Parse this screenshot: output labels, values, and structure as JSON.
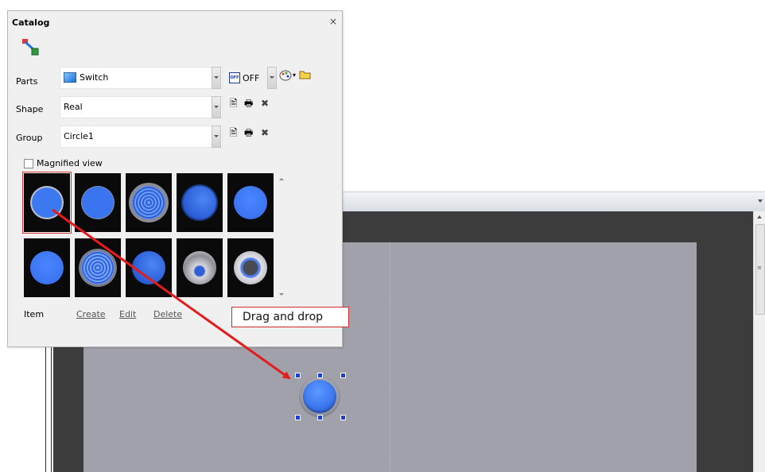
{
  "catalog": {
    "title": "Catalog",
    "close_glyph": "×",
    "parts_label": "Parts",
    "parts_value": "Switch",
    "parts_icon": "switch-icon",
    "state_value": "OFF",
    "shape_label": "Shape",
    "shape_value": "Real",
    "group_label": "Group",
    "group_value": "Circle1",
    "magnified_label": "Magnified view",
    "magnified_checked": false,
    "item_label": "Item",
    "create_label": "Create",
    "edit_label": "Edit",
    "delete_label": "Delete",
    "gallery_selected_index": 0,
    "accent_color": "#3c78f0",
    "selection_color": "#d23a3a"
  },
  "annotation": {
    "text": "Drag and drop",
    "color": "#e31d1d"
  }
}
